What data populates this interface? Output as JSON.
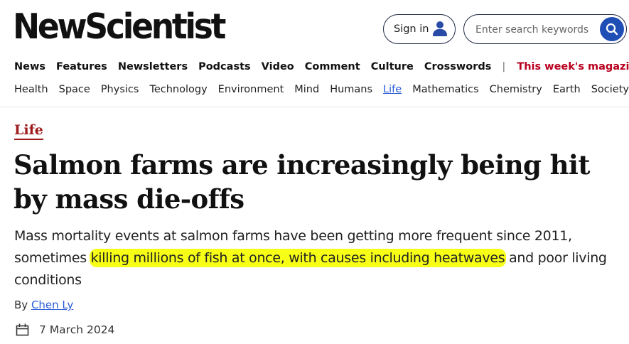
{
  "header": {
    "logo": "NewScientist",
    "signin_label": "Sign in",
    "search_placeholder": "Enter search keywords"
  },
  "nav_primary": [
    {
      "label": "News"
    },
    {
      "label": "Features"
    },
    {
      "label": "Newsletters"
    },
    {
      "label": "Podcasts"
    },
    {
      "label": "Video"
    },
    {
      "label": "Comment"
    },
    {
      "label": "Culture"
    },
    {
      "label": "Crosswords"
    }
  ],
  "magazine_link": "This week's magazine",
  "nav_topics": [
    {
      "label": "Health"
    },
    {
      "label": "Space"
    },
    {
      "label": "Physics"
    },
    {
      "label": "Technology"
    },
    {
      "label": "Environment"
    },
    {
      "label": "Mind"
    },
    {
      "label": "Humans"
    },
    {
      "label": "Life",
      "active": true
    },
    {
      "label": "Mathematics"
    },
    {
      "label": "Chemistry"
    },
    {
      "label": "Earth"
    },
    {
      "label": "Society"
    }
  ],
  "article": {
    "section": "Life",
    "headline": "Salmon farms are increasingly being hit by mass die-offs",
    "standfirst_before": "Mass mortality events at salmon farms have been getting more frequent since 2011, sometimes ",
    "standfirst_highlight": "killing millions of fish at once, with causes including heatwaves",
    "standfirst_after": " and poor living conditions",
    "byline_prefix": "By ",
    "author": "Chen Ly",
    "date": "7 March 2024"
  },
  "colors": {
    "brand_red": "#9e1a1a",
    "magazine_red": "#b8001f",
    "link_blue": "#2a5bd7",
    "highlight_yellow": "#f8ff17",
    "search_button": "#1f4fb5"
  }
}
